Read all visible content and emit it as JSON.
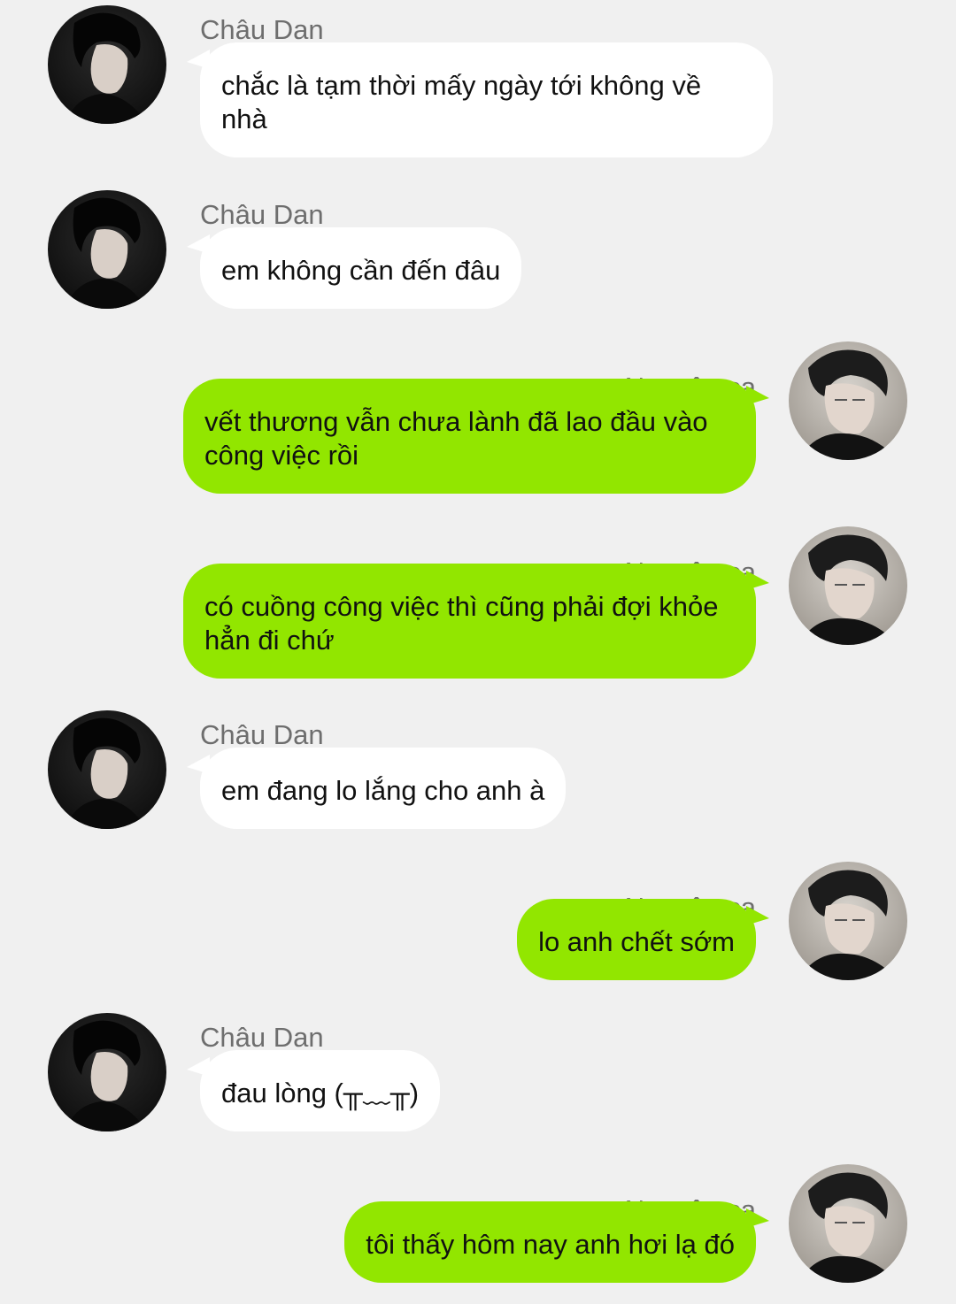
{
  "conversation": {
    "messages": [
      {
        "sender": "Châu Dan",
        "text": "chắc là tạm thời mấy ngày tới không về nhà",
        "side": "left"
      },
      {
        "sender": "Châu Dan",
        "text": "em không cần đến đâu",
        "side": "left"
      },
      {
        "sender": "Nguyên ca",
        "text": "vết thương vẫn chưa lành đã lao đầu vào công việc rồi",
        "side": "right"
      },
      {
        "sender": "Nguyên ca",
        "text": "có cuồng công việc thì cũng phải đợi khỏe hẳn đi chứ",
        "side": "right"
      },
      {
        "sender": "Châu Dan",
        "text": "em đang lo lắng cho anh à",
        "side": "left"
      },
      {
        "sender": "Nguyên ca",
        "text": "lo anh chết sớm",
        "side": "right"
      },
      {
        "sender": "Châu Dan",
        "text": "đau lòng (╥﹏╥)",
        "side": "left"
      },
      {
        "sender": "Nguyên ca",
        "text": "tôi thấy hôm nay anh hơi lạ đó",
        "side": "right"
      }
    ]
  },
  "colors": {
    "background": "#f0f0f0",
    "incoming_bubble": "#ffffff",
    "outgoing_bubble": "#92e600",
    "sender_name": "#6e6e6e",
    "message_text": "#111111"
  }
}
